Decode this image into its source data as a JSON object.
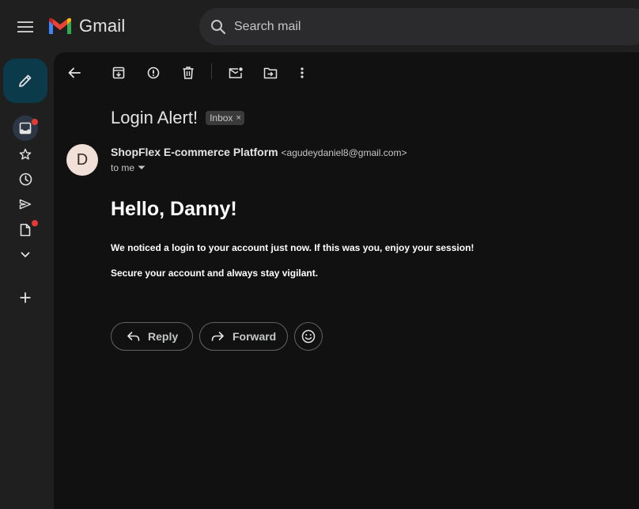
{
  "app": {
    "name": "Gmail"
  },
  "search": {
    "placeholder": "Search mail"
  },
  "email": {
    "subject": "Login Alert!",
    "label": "Inbox",
    "label_remove": "×",
    "sender_initial": "D",
    "sender_name": "ShopFlex E-commerce Platform",
    "sender_email": "<agudeydaniel8@gmail.com>",
    "recipient": "to me",
    "greeting": "Hello, Danny!",
    "paragraph_1": "We noticed a login to your account just now. If this was you, enjoy your session!",
    "paragraph_2": "Secure your account and always stay vigilant."
  },
  "actions": {
    "reply": "Reply",
    "forward": "Forward"
  },
  "colors": {
    "background": "#1f1f1f",
    "content": "#111111",
    "compose": "#0b3a4b",
    "badge": "#e53935",
    "search": "#2b2b2d"
  }
}
